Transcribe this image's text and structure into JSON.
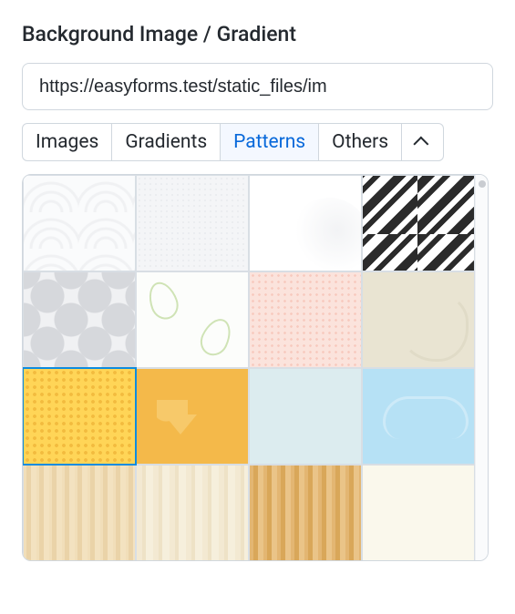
{
  "section": {
    "title": "Background Image / Gradient"
  },
  "input": {
    "url_value": "https://easyforms.test/static_files/im"
  },
  "tabs": {
    "images": "Images",
    "gradients": "Gradients",
    "patterns": "Patterns",
    "others": "Others",
    "active": "patterns"
  },
  "swatches": [
    {
      "id": "concentric-arcs",
      "selected": false
    },
    {
      "id": "light-dot-grid",
      "selected": false
    },
    {
      "id": "soft-curve-white",
      "selected": false
    },
    {
      "id": "diagonal-stripes-bw",
      "selected": false
    },
    {
      "id": "gray-quatrefoil",
      "selected": false
    },
    {
      "id": "green-leaves",
      "selected": false
    },
    {
      "id": "pink-dotted",
      "selected": false
    },
    {
      "id": "beige-stroller",
      "selected": false
    },
    {
      "id": "yellow-dot-grid",
      "selected": true
    },
    {
      "id": "amber-heart",
      "selected": false
    },
    {
      "id": "pale-blue-flat",
      "selected": false
    },
    {
      "id": "sky-cloud",
      "selected": false
    },
    {
      "id": "light-wood",
      "selected": false
    },
    {
      "id": "pale-wood",
      "selected": false
    },
    {
      "id": "warm-wood",
      "selected": false
    },
    {
      "id": "ivory-flat",
      "selected": false
    }
  ]
}
